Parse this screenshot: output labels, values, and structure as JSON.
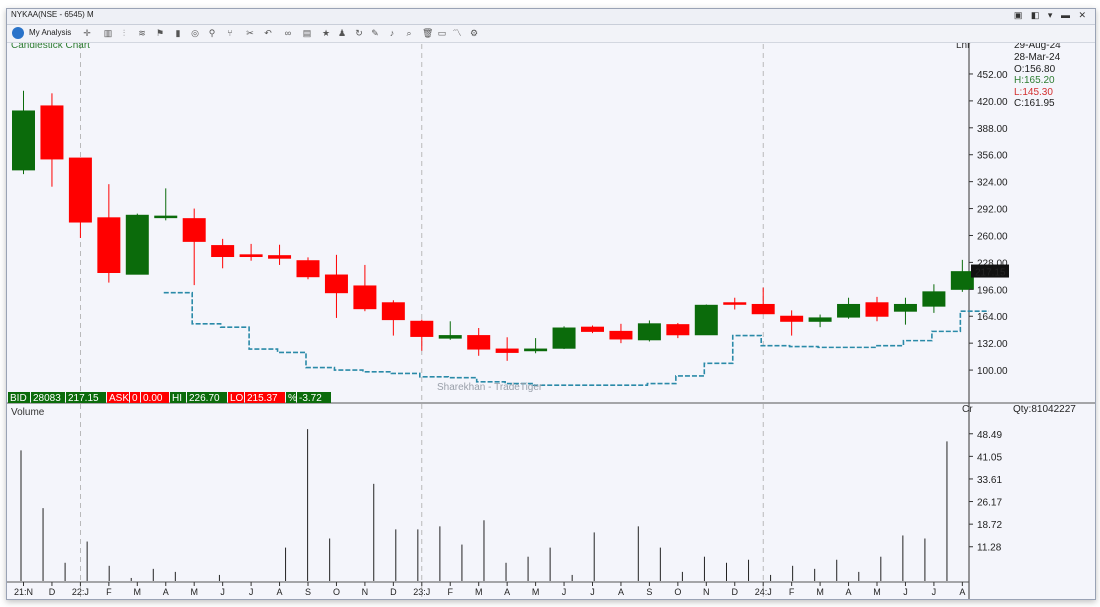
{
  "window": {
    "title": "NYKAA(NSE - 6545) M",
    "controls": "▣ ◧ ▾ ▬ ✕"
  },
  "toolbar": {
    "analysis_label": "My Analysis"
  },
  "chart_title": "Candlestick Chart",
  "scale_label": "Lnr",
  "volume_title": "Volume",
  "volume_unit": "Cr",
  "watermark": "Sharekhan - TradeTiger",
  "info": {
    "date1": "29-Aug-24",
    "date2": "28-Mar-24",
    "open": "O:156.80",
    "high": "H:165.20",
    "low": "L:145.30",
    "close": "C:161.95"
  },
  "last_price_tag": "217.15",
  "qty": "Qty:81042227",
  "quote": {
    "bid_label": "BID",
    "bid_qty": "28083",
    "bid_price": "217.15",
    "ask_label": "ASK",
    "ask_qty": "0",
    "ask_price": "0.00",
    "hi_label": "HI",
    "hi_value": "226.70",
    "lo_label": "LO",
    "lo_value": "215.37",
    "pct_label": "%",
    "pct_value": "-3.72"
  },
  "colors": {
    "up": "#0b6b0b",
    "down": "#ff0000",
    "line": "#2a8aa8",
    "grid": "#aaaaaa"
  },
  "chart_data": [
    {
      "type": "candlestick",
      "title": "Candlestick Chart",
      "y_ticks": [
        "452.00",
        "420.00",
        "388.00",
        "356.00",
        "324.00",
        "292.00",
        "260.00",
        "228.00",
        "196.00",
        "164.00",
        "132.00",
        "100.00"
      ],
      "ylim": [
        68,
        490
      ],
      "x_labels": [
        "21:N",
        "D",
        "22:J",
        "F",
        "M",
        "A",
        "M",
        "J",
        "J",
        "A",
        "S",
        "O",
        "N",
        "D",
        "23:J",
        "F",
        "M",
        "A",
        "M",
        "J",
        "J",
        "A",
        "S",
        "O",
        "N",
        "D",
        "24:J",
        "F",
        "M",
        "A",
        "M",
        "J",
        "J",
        "A"
      ],
      "candles": [
        {
          "o": 338,
          "h": 432,
          "l": 333,
          "c": 408
        },
        {
          "o": 414,
          "h": 429,
          "l": 318,
          "c": 351
        },
        {
          "o": 352,
          "h": 352,
          "l": 257,
          "c": 276
        },
        {
          "o": 281,
          "h": 321,
          "l": 204,
          "c": 216
        },
        {
          "o": 214,
          "h": 286,
          "l": 214,
          "c": 284
        },
        {
          "o": 283,
          "h": 316,
          "l": 278,
          "c": 283
        },
        {
          "o": 280,
          "h": 292,
          "l": 201,
          "c": 253
        },
        {
          "o": 248,
          "h": 256,
          "l": 221,
          "c": 235
        },
        {
          "o": 237,
          "h": 250,
          "l": 230,
          "c": 235
        },
        {
          "o": 236,
          "h": 249,
          "l": 225,
          "c": 233
        },
        {
          "o": 230,
          "h": 234,
          "l": 208,
          "c": 211
        },
        {
          "o": 213,
          "h": 237,
          "l": 162,
          "c": 192
        },
        {
          "o": 200,
          "h": 225,
          "l": 170,
          "c": 173
        },
        {
          "o": 180,
          "h": 183,
          "l": 141,
          "c": 160
        },
        {
          "o": 158,
          "h": 160,
          "l": 123,
          "c": 140
        },
        {
          "o": 138,
          "h": 158,
          "l": 136,
          "c": 141
        },
        {
          "o": 141,
          "h": 150,
          "l": 117,
          "c": 125
        },
        {
          "o": 125,
          "h": 139,
          "l": 111,
          "c": 121
        },
        {
          "o": 123,
          "h": 138,
          "l": 120,
          "c": 125
        },
        {
          "o": 126,
          "h": 152,
          "l": 125,
          "c": 150
        },
        {
          "o": 151,
          "h": 153,
          "l": 144,
          "c": 146
        },
        {
          "o": 146,
          "h": 155,
          "l": 132,
          "c": 137
        },
        {
          "o": 136,
          "h": 159,
          "l": 134,
          "c": 155
        },
        {
          "o": 154,
          "h": 156,
          "l": 138,
          "c": 142
        },
        {
          "o": 142,
          "h": 178,
          "l": 142,
          "c": 177
        },
        {
          "o": 180,
          "h": 186,
          "l": 172,
          "c": 179
        },
        {
          "o": 178,
          "h": 198,
          "l": 167,
          "c": 167
        },
        {
          "o": 164,
          "h": 171,
          "l": 141,
          "c": 158
        },
        {
          "o": 158,
          "h": 166,
          "l": 151,
          "c": 162
        },
        {
          "o": 163,
          "h": 186,
          "l": 161,
          "c": 178
        },
        {
          "o": 180,
          "h": 187,
          "l": 158,
          "c": 164
        },
        {
          "o": 170,
          "h": 186,
          "l": 154,
          "c": 178
        },
        {
          "o": 176,
          "h": 202,
          "l": 168,
          "c": 193
        },
        {
          "o": 196,
          "h": 231,
          "l": 193,
          "c": 217
        }
      ],
      "step_line": [
        null,
        null,
        null,
        null,
        null,
        192,
        155,
        151,
        125,
        121,
        103,
        100,
        98,
        96,
        92,
        91,
        86,
        84,
        82,
        82,
        82,
        82,
        84,
        93,
        108,
        141,
        129,
        128,
        127,
        127,
        129,
        135,
        146,
        170
      ],
      "volume": {
        "y_ticks": [
          "48.49",
          "41.05",
          "33.61",
          "26.17",
          "18.72",
          "11.28"
        ],
        "ylim": [
          0,
          55
        ],
        "values": [
          43,
          24,
          6,
          13,
          5,
          1,
          4,
          3,
          0,
          2,
          0,
          0,
          11,
          50,
          14,
          0,
          32,
          17,
          17,
          18,
          12,
          20,
          6,
          8,
          11,
          2,
          16,
          0,
          18,
          11,
          3,
          8,
          6,
          7,
          2,
          5,
          4,
          7,
          3,
          8,
          15,
          14,
          46
        ]
      }
    }
  ]
}
